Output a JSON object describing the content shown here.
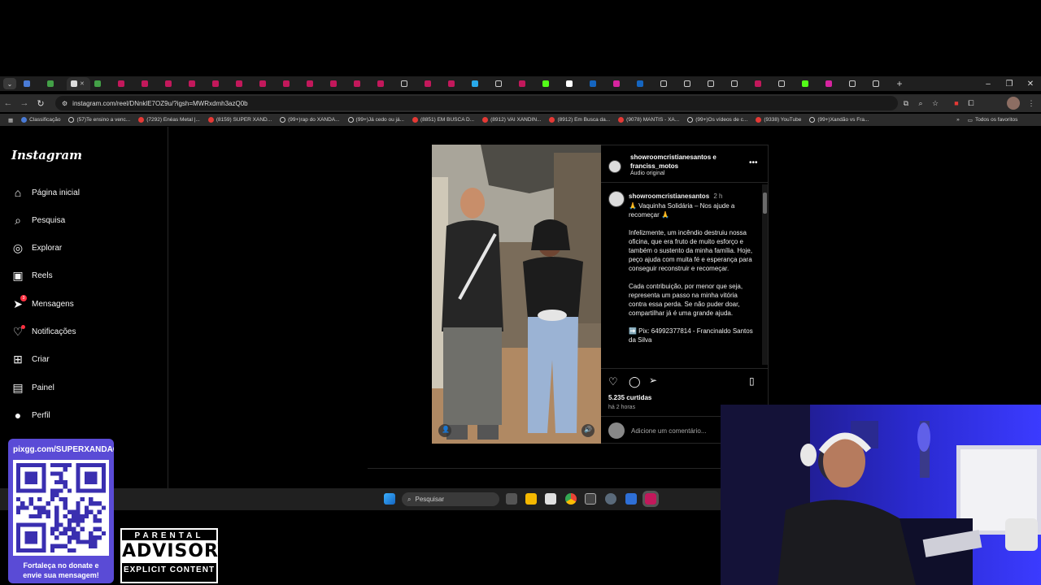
{
  "browser": {
    "address": "instagram.com/reel/DNnklE7OZ9u/?igsh=MWRxdmh3azQ0b",
    "bookmarks": [
      {
        "label": "Classificação",
        "kind": "g"
      },
      {
        "label": "(57)Te ensino a venc...",
        "kind": "tt"
      },
      {
        "label": "(7292) Enéas Metal |...",
        "kind": "yt"
      },
      {
        "label": "(8159) SUPER XAND...",
        "kind": "yt"
      },
      {
        "label": "(99+)rap do XANDÃ...",
        "kind": "tt"
      },
      {
        "label": "(99+)Já cedo ou já...",
        "kind": "tt"
      },
      {
        "label": "(8851) EM BUSCA D...",
        "kind": "yt"
      },
      {
        "label": "(8912) VAI XANDIN...",
        "kind": "yt"
      },
      {
        "label": "(8912) Em Busca da...",
        "kind": "yt"
      },
      {
        "label": "(9078) MANTIS - XA...",
        "kind": "yt"
      },
      {
        "label": "(99+)Os vídeos de c...",
        "kind": "tt"
      },
      {
        "label": "(9338) YouTube",
        "kind": "yt"
      },
      {
        "label": "(99+)Xandão vs Fra...",
        "kind": "tt"
      }
    ],
    "all_bookmarks": "Todos os favoritos"
  },
  "sidebar": {
    "logo": "Instagram",
    "items": [
      {
        "label": "Página inicial",
        "icon": "home-icon"
      },
      {
        "label": "Pesquisa",
        "icon": "search-icon"
      },
      {
        "label": "Explorar",
        "icon": "compass-icon"
      },
      {
        "label": "Reels",
        "icon": "reels-icon"
      },
      {
        "label": "Mensagens",
        "icon": "messenger-icon",
        "badge": "3"
      },
      {
        "label": "Notificações",
        "icon": "heart-icon"
      },
      {
        "label": "Criar",
        "icon": "plus-square-icon"
      },
      {
        "label": "Painel",
        "icon": "chart-icon"
      },
      {
        "label": "Perfil",
        "icon": "profile-avatar-icon"
      }
    ]
  },
  "post": {
    "authors": "showroomcristianesantos e franciss_motos",
    "audio": "Áudio original",
    "caption_user": "showroomcristianesantos",
    "caption_time": "2 h",
    "caption_paragraphs": [
      "🙏 Vaquinha Solidária – Nos ajude a recomeçar 🙏",
      "Infelizmente, um incêndio destruiu nossa oficina, que era fruto de muito esforço e também o sustento da minha família. Hoje, peço ajuda com muita fé e esperança para conseguir reconstruir e recomeçar.",
      "Cada contribuição, por menor que seja, representa um passo na minha vitória contra essa perda. Se não puder doar, compartilhar já é uma grande ajuda.",
      "➡️ Pix: 64992377814 - Francinaldo Santos da Silva"
    ],
    "likes": "5.235 curtidas",
    "posted_ago": "há 2 horas",
    "comment_placeholder": "Adicione um comentário..."
  },
  "taskbar": {
    "search_placeholder": "Pesquisar"
  },
  "overlay": {
    "donate_url": "pixgg.com/SUPERXANDAO",
    "donate_message_1": "Fortaleça no donate e",
    "donate_message_2": "envie sua mensagem!",
    "advisory_top": "PARENTAL",
    "advisory_main": "ADVISORY",
    "advisory_bottom": "EXPLICIT CONTENT"
  },
  "colors": {
    "accent_red": "#ff3040",
    "donate_purple": "#5a4bd6",
    "webcam_blue": "#2a2ad0"
  }
}
